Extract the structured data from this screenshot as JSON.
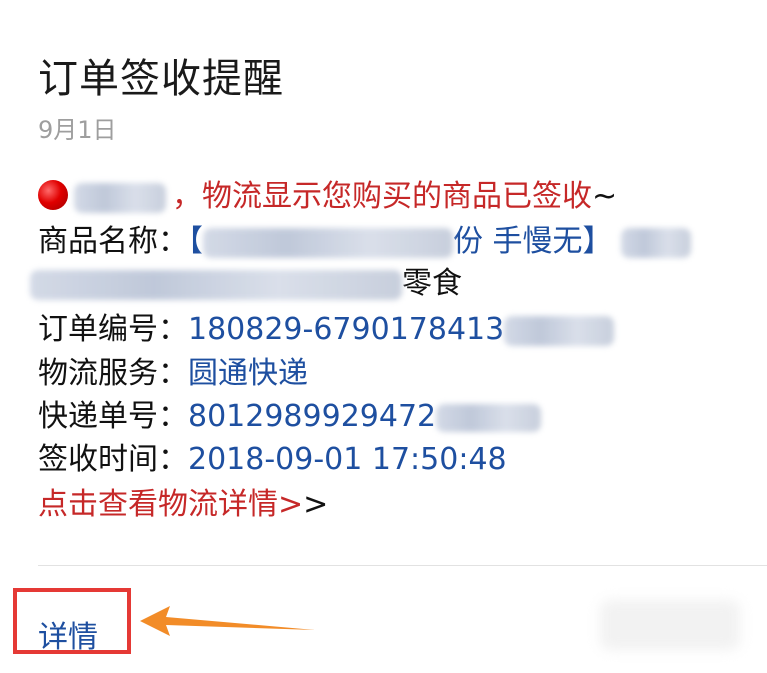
{
  "notification": {
    "title": "订单签收提醒",
    "date": "9月1日",
    "line1_text": "，物流显示您购买的商品已签收",
    "line1_tail": "~",
    "product_label": "商品名称：",
    "product_open": "【",
    "product_visible": "份 手慢无】",
    "product_end": "零食",
    "order_label": "订单编号：",
    "order_value": "180829-6790178413",
    "logistics_label": "物流服务：",
    "logistics_value": "圆通快递",
    "tracking_label": "快递单号：",
    "tracking_value": "8012989929472",
    "signed_label": "签收时间：",
    "signed_value": "2018-09-01 17:50:48",
    "view_link": "点击查看物流详情>",
    "view_link_tail": ">"
  },
  "footer": {
    "detail_label": "详情"
  },
  "colors": {
    "accent_red": "#c62828",
    "link_blue": "#1e4fa0",
    "highlight_box": "#e53935",
    "arrow": "#f28c28"
  }
}
